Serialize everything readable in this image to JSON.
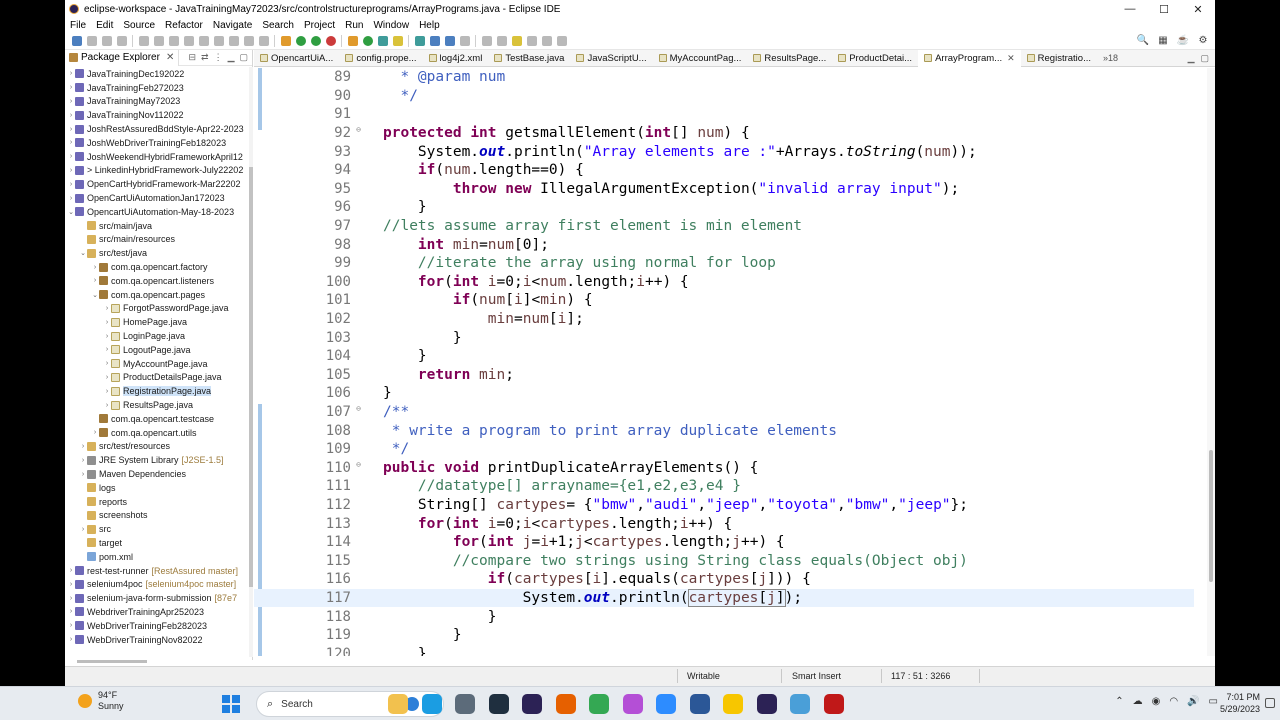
{
  "window": {
    "title": "eclipse-workspace - JavaTrainingMay72023/src/controlstructureprograms/ArrayPrograms.java - Eclipse IDE",
    "minimize": "—",
    "maximize": "☐",
    "close": "✕"
  },
  "menu": [
    "File",
    "Edit",
    "Source",
    "Refactor",
    "Navigate",
    "Search",
    "Project",
    "Run",
    "Window",
    "Help"
  ],
  "explorer": {
    "title": "Package Explorer",
    "items": [
      {
        "label": "JavaTrainingDec192022",
        "icon": "proj",
        "indent": 0,
        "arrow": ">"
      },
      {
        "label": "JavaTrainingFeb272023",
        "icon": "proj",
        "indent": 0,
        "arrow": ">"
      },
      {
        "label": "JavaTrainingMay72023",
        "icon": "proj",
        "indent": 0,
        "arrow": ">"
      },
      {
        "label": "JavaTrainingNov112022",
        "icon": "proj",
        "indent": 0,
        "arrow": ">"
      },
      {
        "label": "JoshRestAssuredBddStyle-Apr22-2023",
        "icon": "proj",
        "indent": 0,
        "arrow": ">"
      },
      {
        "label": "JoshWebDriverTrainingFeb182023",
        "icon": "proj",
        "indent": 0,
        "arrow": ">"
      },
      {
        "label": "JoshWeekendHybridFrameworkApril12",
        "icon": "proj",
        "indent": 0,
        "arrow": ">"
      },
      {
        "label": "> LinkedinHybridFramework-July22202",
        "icon": "proj",
        "indent": 0,
        "arrow": ">"
      },
      {
        "label": "OpenCartHybridFramework-Mar22202",
        "icon": "proj",
        "indent": 0,
        "arrow": ">"
      },
      {
        "label": "OpenCartUiAutomationJan172023",
        "icon": "proj",
        "indent": 0,
        "arrow": ">"
      },
      {
        "label": "OpencartUiAutomation-May-18-2023",
        "icon": "proj",
        "indent": 0,
        "arrow": "v"
      },
      {
        "label": "src/main/java",
        "icon": "folder",
        "indent": 1,
        "arrow": ""
      },
      {
        "label": "src/main/resources",
        "icon": "folder",
        "indent": 1,
        "arrow": ""
      },
      {
        "label": "src/test/java",
        "icon": "folder",
        "indent": 1,
        "arrow": "v"
      },
      {
        "label": "com.qa.opencart.factory",
        "icon": "pkg",
        "indent": 2,
        "arrow": ">"
      },
      {
        "label": "com.qa.opencart.listeners",
        "icon": "pkg",
        "indent": 2,
        "arrow": ">"
      },
      {
        "label": "com.qa.opencart.pages",
        "icon": "pkg",
        "indent": 2,
        "arrow": "v"
      },
      {
        "label": "ForgotPasswordPage.java",
        "icon": "java",
        "indent": 3,
        "arrow": ">"
      },
      {
        "label": "HomePage.java",
        "icon": "java",
        "indent": 3,
        "arrow": ">"
      },
      {
        "label": "LoginPage.java",
        "icon": "java",
        "indent": 3,
        "arrow": ">"
      },
      {
        "label": "LogoutPage.java",
        "icon": "java",
        "indent": 3,
        "arrow": ">"
      },
      {
        "label": "MyAccountPage.java",
        "icon": "java",
        "indent": 3,
        "arrow": ">"
      },
      {
        "label": "ProductDetailsPage.java",
        "icon": "java",
        "indent": 3,
        "arrow": ">"
      },
      {
        "label": "RegistrationPage.java",
        "icon": "java",
        "indent": 3,
        "arrow": ">",
        "selected": true
      },
      {
        "label": "ResultsPage.java",
        "icon": "java",
        "indent": 3,
        "arrow": ">"
      },
      {
        "label": "com.qa.opencart.testcase",
        "icon": "pkg",
        "indent": 2,
        "arrow": ""
      },
      {
        "label": "com.qa.opencart.utils",
        "icon": "pkg",
        "indent": 2,
        "arrow": ">"
      },
      {
        "label": "src/test/resources",
        "icon": "folder",
        "indent": 1,
        "arrow": ">"
      },
      {
        "label": "JRE System Library",
        "icon": "lib",
        "indent": 1,
        "arrow": ">",
        "deco": "[J2SE-1.5]"
      },
      {
        "label": "Maven Dependencies",
        "icon": "lib",
        "indent": 1,
        "arrow": ">"
      },
      {
        "label": "logs",
        "icon": "folder",
        "indent": 1,
        "arrow": ""
      },
      {
        "label": "reports",
        "icon": "folder",
        "indent": 1,
        "arrow": ""
      },
      {
        "label": "screenshots",
        "icon": "folder",
        "indent": 1,
        "arrow": ""
      },
      {
        "label": "src",
        "icon": "folder",
        "indent": 1,
        "arrow": ">"
      },
      {
        "label": "target",
        "icon": "folder",
        "indent": 1,
        "arrow": ""
      },
      {
        "label": "pom.xml",
        "icon": "xml",
        "indent": 1,
        "arrow": ""
      },
      {
        "label": "rest-test-runner",
        "icon": "proj",
        "indent": 0,
        "arrow": ">",
        "deco": "[RestAssured master]"
      },
      {
        "label": "selenium4poc",
        "icon": "proj",
        "indent": 0,
        "arrow": ">",
        "deco": "[selenium4poc master]"
      },
      {
        "label": "selenium-java-form-submission",
        "icon": "proj",
        "indent": 0,
        "arrow": ">",
        "deco": "[87e7"
      },
      {
        "label": "WebdriverTrainingApr252023",
        "icon": "proj",
        "indent": 0,
        "arrow": ">"
      },
      {
        "label": "WebDriverTrainingFeb282023",
        "icon": "proj",
        "indent": 0,
        "arrow": ">"
      },
      {
        "label": "WebDriverTrainingNov82022",
        "icon": "proj",
        "indent": 0,
        "arrow": ">"
      }
    ]
  },
  "editor": {
    "tabs": [
      {
        "label": "OpencartUiA...",
        "active": false
      },
      {
        "label": "config.prope...",
        "active": false
      },
      {
        "label": "log4j2.xml",
        "active": false
      },
      {
        "label": "TestBase.java",
        "active": false
      },
      {
        "label": "JavaScriptU...",
        "active": false
      },
      {
        "label": "MyAccountPag...",
        "active": false
      },
      {
        "label": "ResultsPage...",
        "active": false
      },
      {
        "label": "ProductDetai...",
        "active": false
      },
      {
        "label": "ArrayProgram...",
        "active": true
      },
      {
        "label": "Registratio...",
        "active": false
      }
    ],
    "overflow_count": "»18",
    "current_line": 117,
    "lines": [
      {
        "n": 89,
        "fold": "",
        "html": "  <span class=\"jd\">* @param num</span>"
      },
      {
        "n": 90,
        "fold": "",
        "html": "  <span class=\"jd\">*/</span>"
      },
      {
        "n": 91,
        "fold": "",
        "html": ""
      },
      {
        "n": 92,
        "fold": "⊖",
        "html": "<span class=\"kw\">protected</span> <span class=\"kw\">int</span> getsmallElement(<span class=\"kw\">int</span>[] <span class=\"par\">num</span>) {"
      },
      {
        "n": 93,
        "fold": "",
        "html": "    System.<span class=\"fld\">out</span>.println(<span class=\"str\">\"Array elements are :\"</span>+Arrays.<span class=\"it\">toString</span>(<span class=\"par\">num</span>));"
      },
      {
        "n": 94,
        "fold": "",
        "html": "    <span class=\"kw\">if</span>(<span class=\"par\">num</span>.length==0) {"
      },
      {
        "n": 95,
        "fold": "",
        "html": "        <span class=\"kw\">throw</span> <span class=\"kw\">new</span> IllegalArgumentException(<span class=\"str\">\"invalid array input\"</span>);"
      },
      {
        "n": 96,
        "fold": "",
        "html": "    }"
      },
      {
        "n": 97,
        "fold": "",
        "html": "<span class=\"cm\">//lets assume array first element is min element</span>"
      },
      {
        "n": 98,
        "fold": "",
        "html": "    <span class=\"kw\">int</span> <span class=\"par\">min</span>=<span class=\"par\">num</span>[0];"
      },
      {
        "n": 99,
        "fold": "",
        "html": "    <span class=\"cm\">//iterate the array using normal for loop</span>"
      },
      {
        "n": 100,
        "fold": "",
        "html": "    <span class=\"kw\">for</span>(<span class=\"kw\">int</span> <span class=\"par\">i</span>=0;<span class=\"par\">i</span>&lt;<span class=\"par\">num</span>.length;<span class=\"par\">i</span>++) {"
      },
      {
        "n": 101,
        "fold": "",
        "html": "        <span class=\"kw\">if</span>(<span class=\"par\">num</span>[<span class=\"par\">i</span>]&lt;<span class=\"par\">min</span>) {"
      },
      {
        "n": 102,
        "fold": "",
        "html": "            <span class=\"par\">min</span>=<span class=\"par\">num</span>[<span class=\"par\">i</span>];"
      },
      {
        "n": 103,
        "fold": "",
        "html": "        }"
      },
      {
        "n": 104,
        "fold": "",
        "html": "    }"
      },
      {
        "n": 105,
        "fold": "",
        "html": "    <span class=\"kw\">return</span> <span class=\"par\">min</span>;"
      },
      {
        "n": 106,
        "fold": "",
        "html": "}"
      },
      {
        "n": 107,
        "fold": "⊖",
        "html": "<span class=\"jd\">/**</span>"
      },
      {
        "n": 108,
        "fold": "",
        "html": " <span class=\"jd\">* write a program to print array duplicate elements</span>"
      },
      {
        "n": 109,
        "fold": "",
        "html": " <span class=\"jd\">*/</span>"
      },
      {
        "n": 110,
        "fold": "⊖",
        "html": "<span class=\"kw\">public</span> <span class=\"kw\">void</span> printDuplicateArrayElements() {"
      },
      {
        "n": 111,
        "fold": "",
        "html": "    <span class=\"cm\">//datatype[] arrayname={e1,e2,e3,e4 }</span>"
      },
      {
        "n": 112,
        "fold": "",
        "html": "    String[] <span class=\"par\">cartypes</span>= {<span class=\"str\">\"bmw\"</span>,<span class=\"str\">\"audi\"</span>,<span class=\"str\">\"jeep\"</span>,<span class=\"str\">\"toyota\"</span>,<span class=\"str\">\"bmw\"</span>,<span class=\"str\">\"jeep\"</span>};"
      },
      {
        "n": 113,
        "fold": "",
        "html": "    <span class=\"kw\">for</span>(<span class=\"kw\">int</span> <span class=\"par\">i</span>=0;<span class=\"par\">i</span>&lt;<span class=\"par\">cartypes</span>.length;<span class=\"par\">i</span>++) {"
      },
      {
        "n": 114,
        "fold": "",
        "html": "        <span class=\"kw\">for</span>(<span class=\"kw\">int</span> <span class=\"par\">j</span>=<span class=\"par\">i</span>+1;<span class=\"par\">j</span>&lt;<span class=\"par\">cartypes</span>.length;<span class=\"par\">j</span>++) {"
      },
      {
        "n": 115,
        "fold": "",
        "html": "        <span class=\"cm\">//compare two strings using String class equals(Object obj)</span>"
      },
      {
        "n": 116,
        "fold": "",
        "html": "            <span class=\"kw\">if</span>(<span class=\"par\">cartypes</span>[<span class=\"par\">i</span>].equals(<span class=\"par\">cartypes</span>[<span class=\"par\">j</span>])) {"
      },
      {
        "n": 117,
        "fold": "",
        "html": "                System.<span class=\"fld\">out</span>.println(<span class=\"cursor-box\"><span class=\"par\">cartypes</span>[<span class=\"par\">j</span>]</span>);"
      },
      {
        "n": 118,
        "fold": "",
        "html": "            }"
      },
      {
        "n": 119,
        "fold": "",
        "html": "        }"
      },
      {
        "n": 120,
        "fold": "",
        "html": "    }"
      }
    ]
  },
  "status": {
    "writable": "Writable",
    "insert_mode": "Smart Insert",
    "position": "117 : 51 : 3266"
  },
  "taskbar": {
    "temperature": "94°F",
    "condition": "Sunny",
    "search_placeholder": "Search",
    "time": "7:01 PM",
    "date": "5/29/2023",
    "apps": [
      {
        "name": "file-explorer-icon",
        "color": "#f2c14e"
      },
      {
        "name": "edge-icon",
        "color": "#1b9de2"
      },
      {
        "name": "camera-icon",
        "color": "#5c6b7a"
      },
      {
        "name": "dell-icon",
        "color": "#1f2f3f"
      },
      {
        "name": "eclipse-taskbar-icon",
        "color": "#2c2255"
      },
      {
        "name": "firefox-icon",
        "color": "#e66000"
      },
      {
        "name": "chrome-icon",
        "color": "#34a853"
      },
      {
        "name": "snipping-icon",
        "color": "#b44fd6"
      },
      {
        "name": "zoom-icon",
        "color": "#2d8cff"
      },
      {
        "name": "word-icon",
        "color": "#2b5797"
      },
      {
        "name": "sticky-icon",
        "color": "#f7c600"
      },
      {
        "name": "eclipse-icon-2",
        "color": "#2c2255"
      },
      {
        "name": "network-app-icon",
        "color": "#4a9fd8"
      },
      {
        "name": "mcafee-icon",
        "color": "#c01818"
      }
    ]
  }
}
